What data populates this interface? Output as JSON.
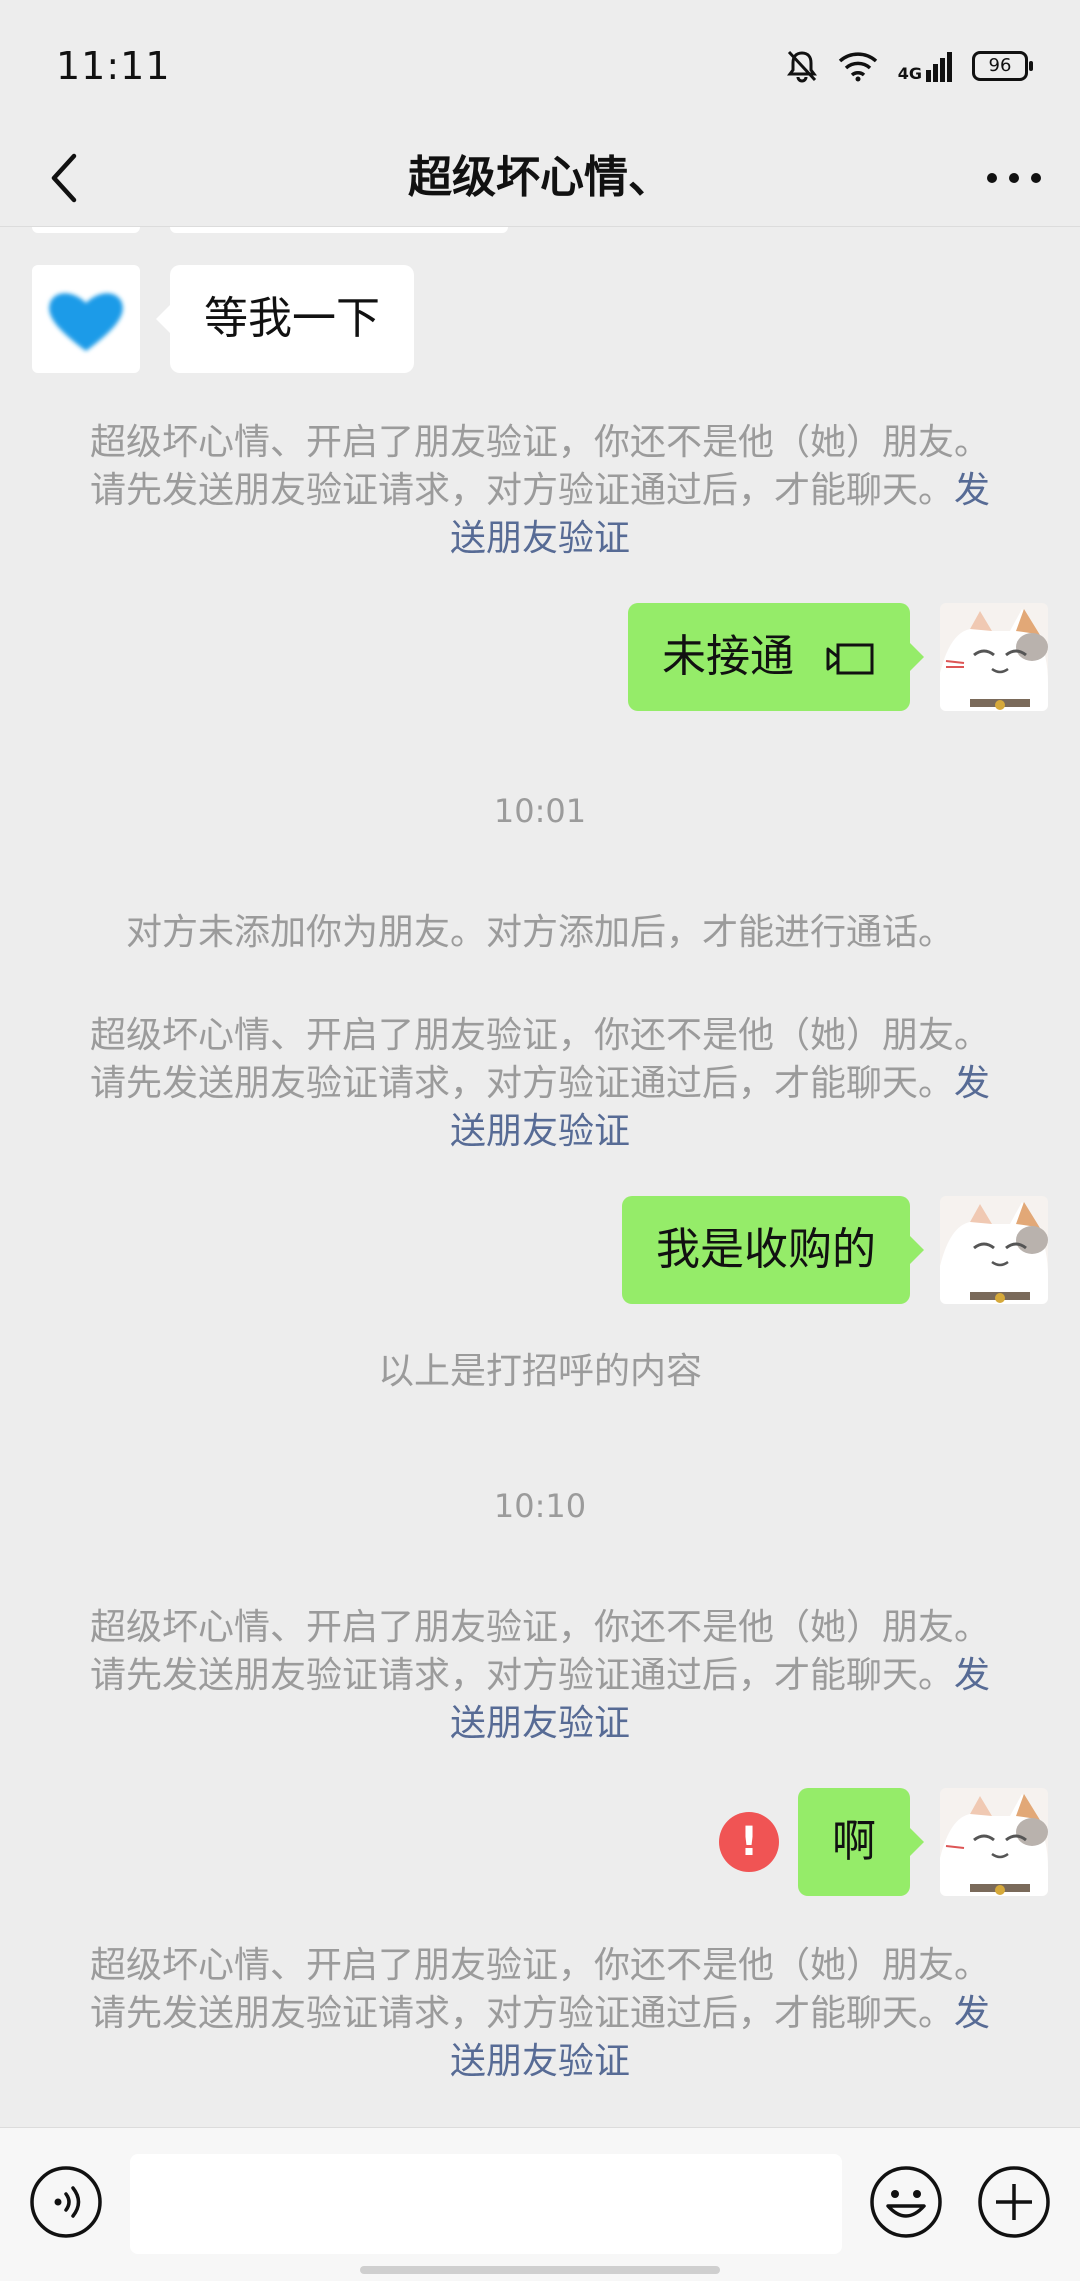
{
  "status_bar": {
    "time": "11:11",
    "network": "4G",
    "battery": "96"
  },
  "header": {
    "title": "超级坏心情、"
  },
  "messages": {
    "wait": "等我一下",
    "missed_call": "未接通",
    "buy": "我是收购的",
    "ah": "啊"
  },
  "system": {
    "verify_text": "超级坏心情、开启了朋友验证，你还不是他（她）朋友。请先发送朋友验证请求，对方验证通过后，才能聊天。",
    "verify_link": "发送朋友验证",
    "not_added": "对方未添加你为朋友。对方添加后，才能进行通话。",
    "greeting_note": "以上是打招呼的内容"
  },
  "timestamps": {
    "t1": "10:01",
    "t2": "10:10"
  },
  "error_badge": "!",
  "colors": {
    "bg": "#ededed",
    "bubble_out": "#95ec69",
    "link": "#576b95",
    "error": "#f05454"
  }
}
